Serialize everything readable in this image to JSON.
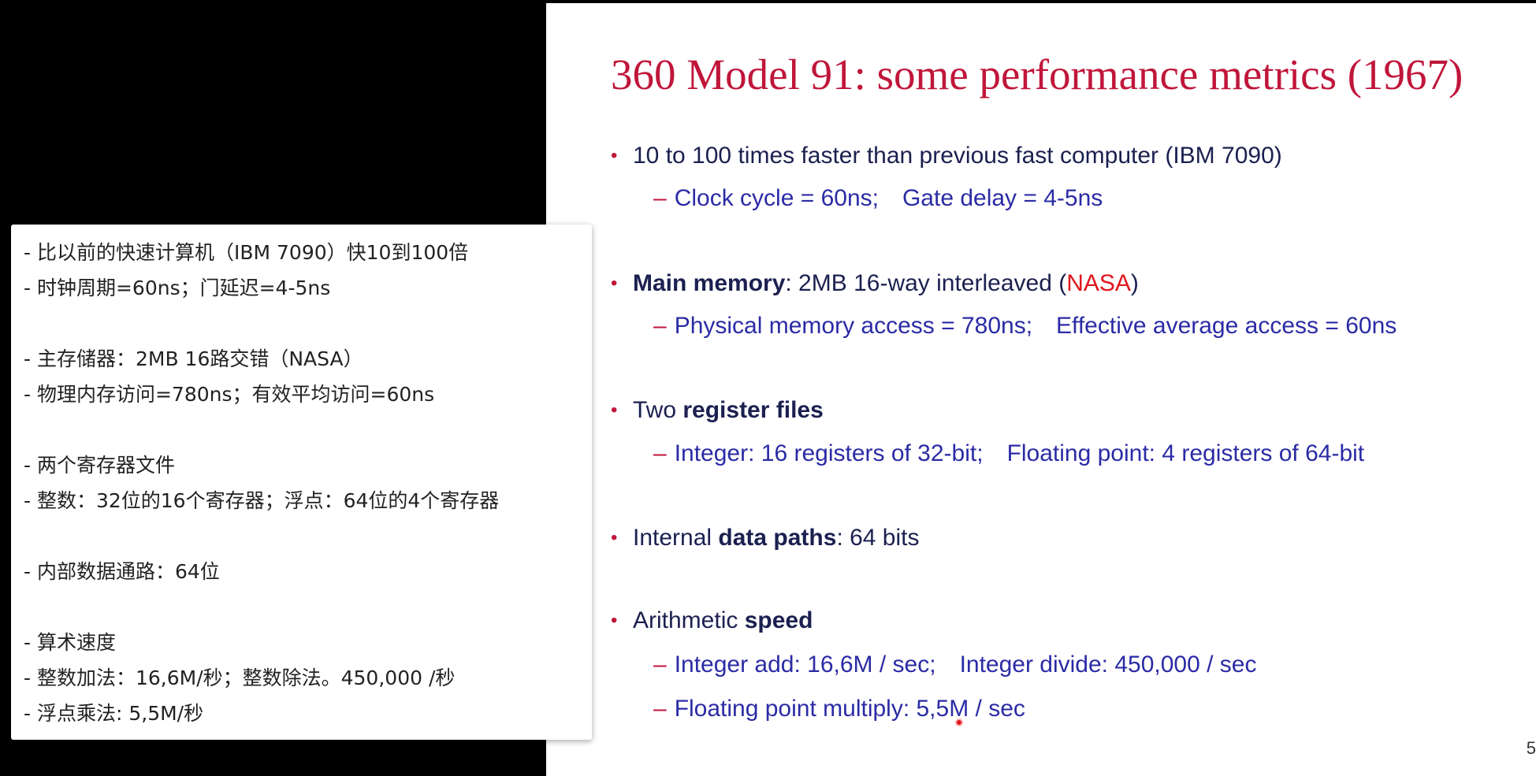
{
  "slide": {
    "title": "360 Model 91: some performance metrics (1967)",
    "page_number": "5",
    "bullets": [
      {
        "pre": "10 to 100 times faster than previous fast computer (IBM 7090)",
        "bold": "",
        "post": "",
        "subs": [
          {
            "a": "Clock cycle = 60ns;",
            "b": "Gate delay = 4-5ns"
          }
        ]
      },
      {
        "pre": "",
        "bold": "Main memory",
        "post": ": 2MB 16-way interleaved (",
        "highlight": "NASA",
        "end": ")",
        "subs": [
          {
            "a": "Physical memory access = 780ns;",
            "b": "Effective average access = 60ns"
          }
        ]
      },
      {
        "pre": "Two ",
        "bold": "register files",
        "post": "",
        "subs": [
          {
            "a": "Integer: 16 registers of 32-bit;",
            "b": "Floating point: 4 registers of 64-bit"
          }
        ]
      },
      {
        "pre": "Internal ",
        "bold": "data paths",
        "post": ": 64 bits",
        "subs": []
      },
      {
        "pre": "Arithmetic ",
        "bold": "speed",
        "post": "",
        "subs": [
          {
            "a": "Integer add: 16,6M / sec;",
            "b": "Integer divide: 450,000 / sec"
          },
          {
            "a": "Floating point multiply: 5,5M / sec",
            "b": ""
          }
        ]
      }
    ],
    "colors": {
      "title": "#c0163a",
      "bullet_text": "#1b2050",
      "sub_text": "#2b2ba6",
      "highlight": "#e0161e"
    }
  },
  "subtitles": {
    "lines": [
      "- 比以前的快速计算机（IBM 7090）快10到100倍",
      "- 时钟周期=60ns；门延迟=4-5ns",
      "",
      "- 主存储器：2MB 16路交错（NASA）",
      "- 物理内存访问=780ns；有效平均访问=60ns",
      "",
      "- 两个寄存器文件",
      "- 整数：32位的16个寄存器；浮点：64位的4个寄存器",
      "",
      "- 内部数据通路：64位",
      "",
      "- 算术速度",
      "- 整数加法：16,6M/秒；整数除法。450,000 /秒",
      "- 浮点乘法: 5,5M/秒"
    ]
  }
}
